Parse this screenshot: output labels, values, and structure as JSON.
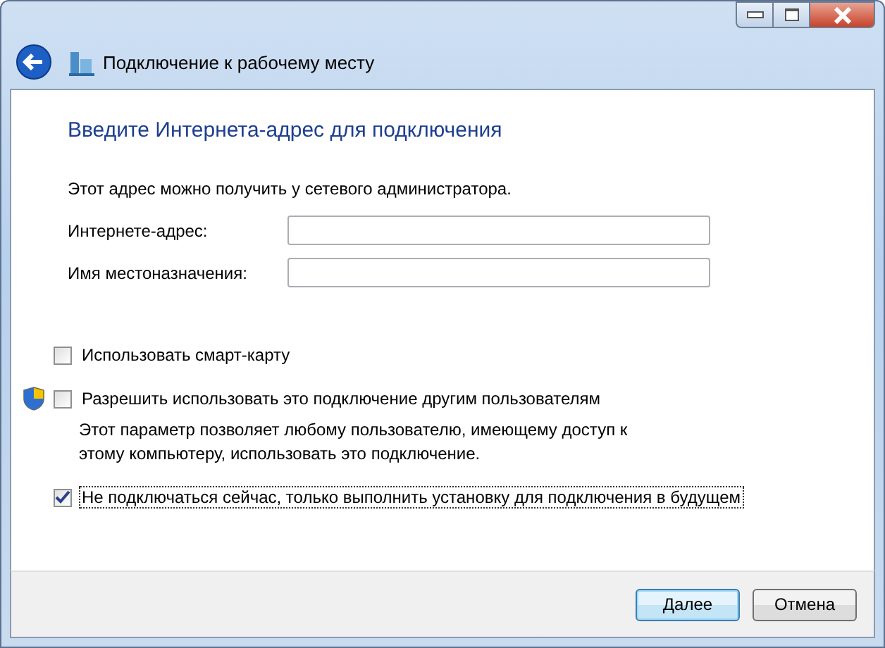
{
  "window": {
    "title": "Подключение к рабочему месту"
  },
  "heading": "Введите Интернета-адрес для подключения",
  "intro": "Этот адрес можно получить у сетевого администратора.",
  "fields": [
    {
      "label": "Интернете-адрес:"
    },
    {
      "label": "Имя местоназначения:"
    }
  ],
  "options": [
    {
      "label": "Использовать смарт-карту",
      "checked": false,
      "shield": false,
      "focused": false
    },
    {
      "label": "Разрешить использовать это подключение другим пользователям",
      "checked": false,
      "shield": true,
      "focused": false,
      "description": "Этот параметр позволяет любому пользователю, имеющему доступ к этому компьютеру, использовать это подключение."
    },
    {
      "label": "Не подключаться сейчас, только выполнить установку для подключения в будущем",
      "checked": true,
      "shield": false,
      "focused": true
    }
  ],
  "buttons": [
    {
      "label": "Далее",
      "default": true
    },
    {
      "label": "Отмена",
      "default": false
    }
  ]
}
